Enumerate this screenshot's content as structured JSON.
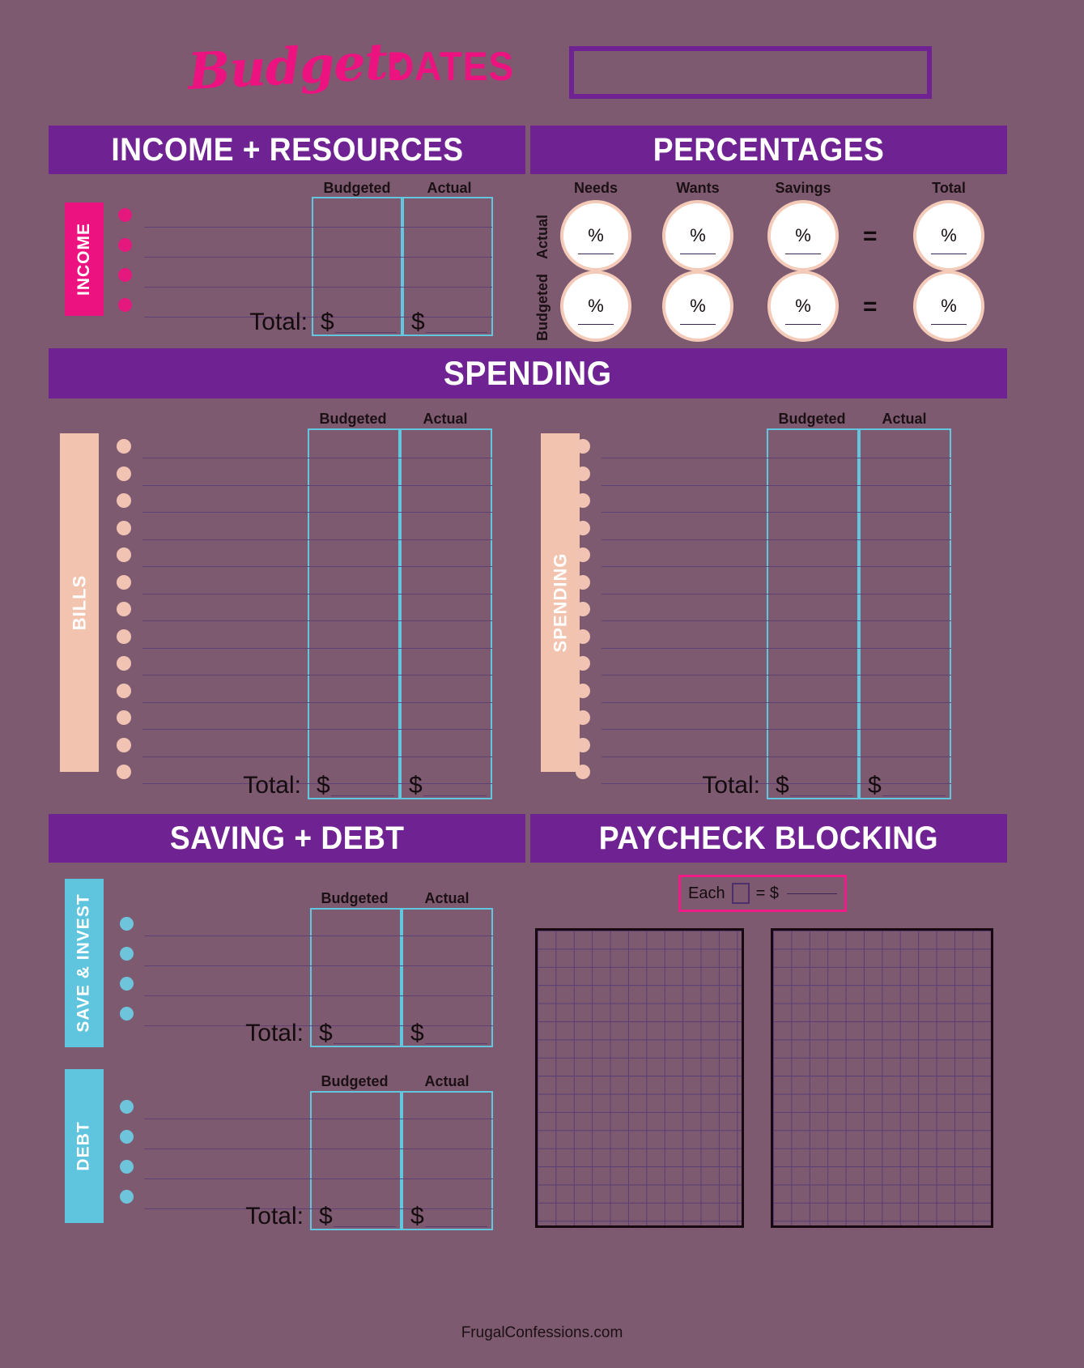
{
  "title": {
    "script_word": "Budget:",
    "dates_word": "DATES",
    "date_box_value": ""
  },
  "sections": {
    "income": {
      "header": "INCOME + RESOURCES",
      "tab_label": "INCOME",
      "col_budgeted": "Budgeted",
      "col_actual": "Actual",
      "total_label": "Total:",
      "currency": "$",
      "rows": 4,
      "budgeted_total": "",
      "actual_total": ""
    },
    "percentages": {
      "header": "PERCENTAGES",
      "columns": [
        "Needs",
        "Wants",
        "Savings",
        "Total"
      ],
      "rows": [
        "Actual",
        "Budgeted"
      ],
      "percent_symbol": "%",
      "equals_symbol": "=",
      "values": {
        "actual": {
          "needs": "",
          "wants": "",
          "savings": "",
          "total": ""
        },
        "budgeted": {
          "needs": "",
          "wants": "",
          "savings": "",
          "total": ""
        }
      }
    },
    "spending": {
      "header": "SPENDING",
      "bills": {
        "tab_label": "BILLS",
        "col_budgeted": "Budgeted",
        "col_actual": "Actual",
        "total_label": "Total:",
        "currency": "$",
        "rows": 13,
        "budgeted_total": "",
        "actual_total": ""
      },
      "spending_list": {
        "tab_label": "SPENDING",
        "col_budgeted": "Budgeted",
        "col_actual": "Actual",
        "total_label": "Total:",
        "currency": "$",
        "rows": 13,
        "budgeted_total": "",
        "actual_total": ""
      }
    },
    "saving_debt": {
      "header": "SAVING + DEBT",
      "save_invest": {
        "tab_label": "SAVE & INVEST",
        "col_budgeted": "Budgeted",
        "col_actual": "Actual",
        "total_label": "Total:",
        "currency": "$",
        "rows": 4,
        "budgeted_total": "",
        "actual_total": ""
      },
      "debt": {
        "tab_label": "DEBT",
        "col_budgeted": "Budgeted",
        "col_actual": "Actual",
        "total_label": "Total:",
        "currency": "$",
        "rows": 4,
        "budgeted_total": "",
        "actual_total": ""
      }
    },
    "paycheck_blocking": {
      "header": "PAYCHECK BLOCKING",
      "legend_prefix": "Each",
      "legend_equals": "= $",
      "legend_value": "",
      "grid_left_cols": 11,
      "grid_left_rows": 16,
      "grid_right_cols": 12,
      "grid_right_rows": 16
    }
  },
  "footer": {
    "site": "FrugalConfessions.com"
  },
  "colors": {
    "background": "#7d5a70",
    "header_purple": "#6f2291",
    "hot_pink": "#ec1280",
    "peach": "#f2c4b0",
    "teal": "#5fc4dd",
    "rule_purple": "#5b3d74",
    "grid_border": "#17090f"
  }
}
